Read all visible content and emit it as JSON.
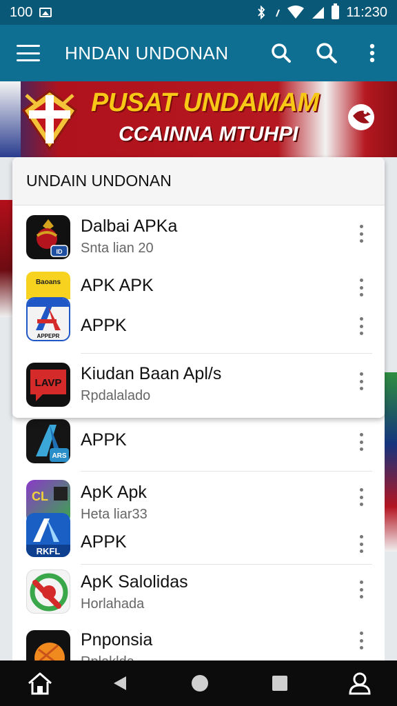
{
  "status_bar": {
    "left_number": "100",
    "time": "11:230"
  },
  "app_bar": {
    "title": "HNDAN UNDONAN"
  },
  "banner": {
    "line1": "PUSAT UNDAMAM",
    "line2": "CCAINNA MTUHPI"
  },
  "section": {
    "header": "UNDAIN UNDONAN"
  },
  "apps": [
    {
      "title": "Dalbai APKa",
      "subtitle": "Snta lian 20"
    },
    {
      "title": "APK APK",
      "subtitle": ""
    },
    {
      "title": "APPK",
      "subtitle": ""
    },
    {
      "title": "Kiudan Baan Apl/s",
      "subtitle": "Rpdalalado"
    },
    {
      "title": "APPK",
      "subtitle": ""
    },
    {
      "title": "ApK Apk",
      "subtitle": "Heta liar33"
    },
    {
      "title": "APPK",
      "subtitle": ""
    },
    {
      "title": "ApK Salolidas",
      "subtitle": "Horlahada"
    },
    {
      "title": "Pnponsia",
      "subtitle": "Rplaklda"
    }
  ],
  "icons": {
    "menu": "hamburger-menu-icon",
    "search": "search-icon",
    "more": "overflow-menu-icon",
    "home": "home-icon",
    "back": "back-triangle-icon",
    "home_circle": "home-circle-icon",
    "recents": "recents-square-icon",
    "profile": "person-icon"
  },
  "colors": {
    "app_bar": "#0e6f93",
    "status_bar": "#0a5877",
    "banner_red": "#b51820",
    "banner_yellow": "#f7c816"
  }
}
